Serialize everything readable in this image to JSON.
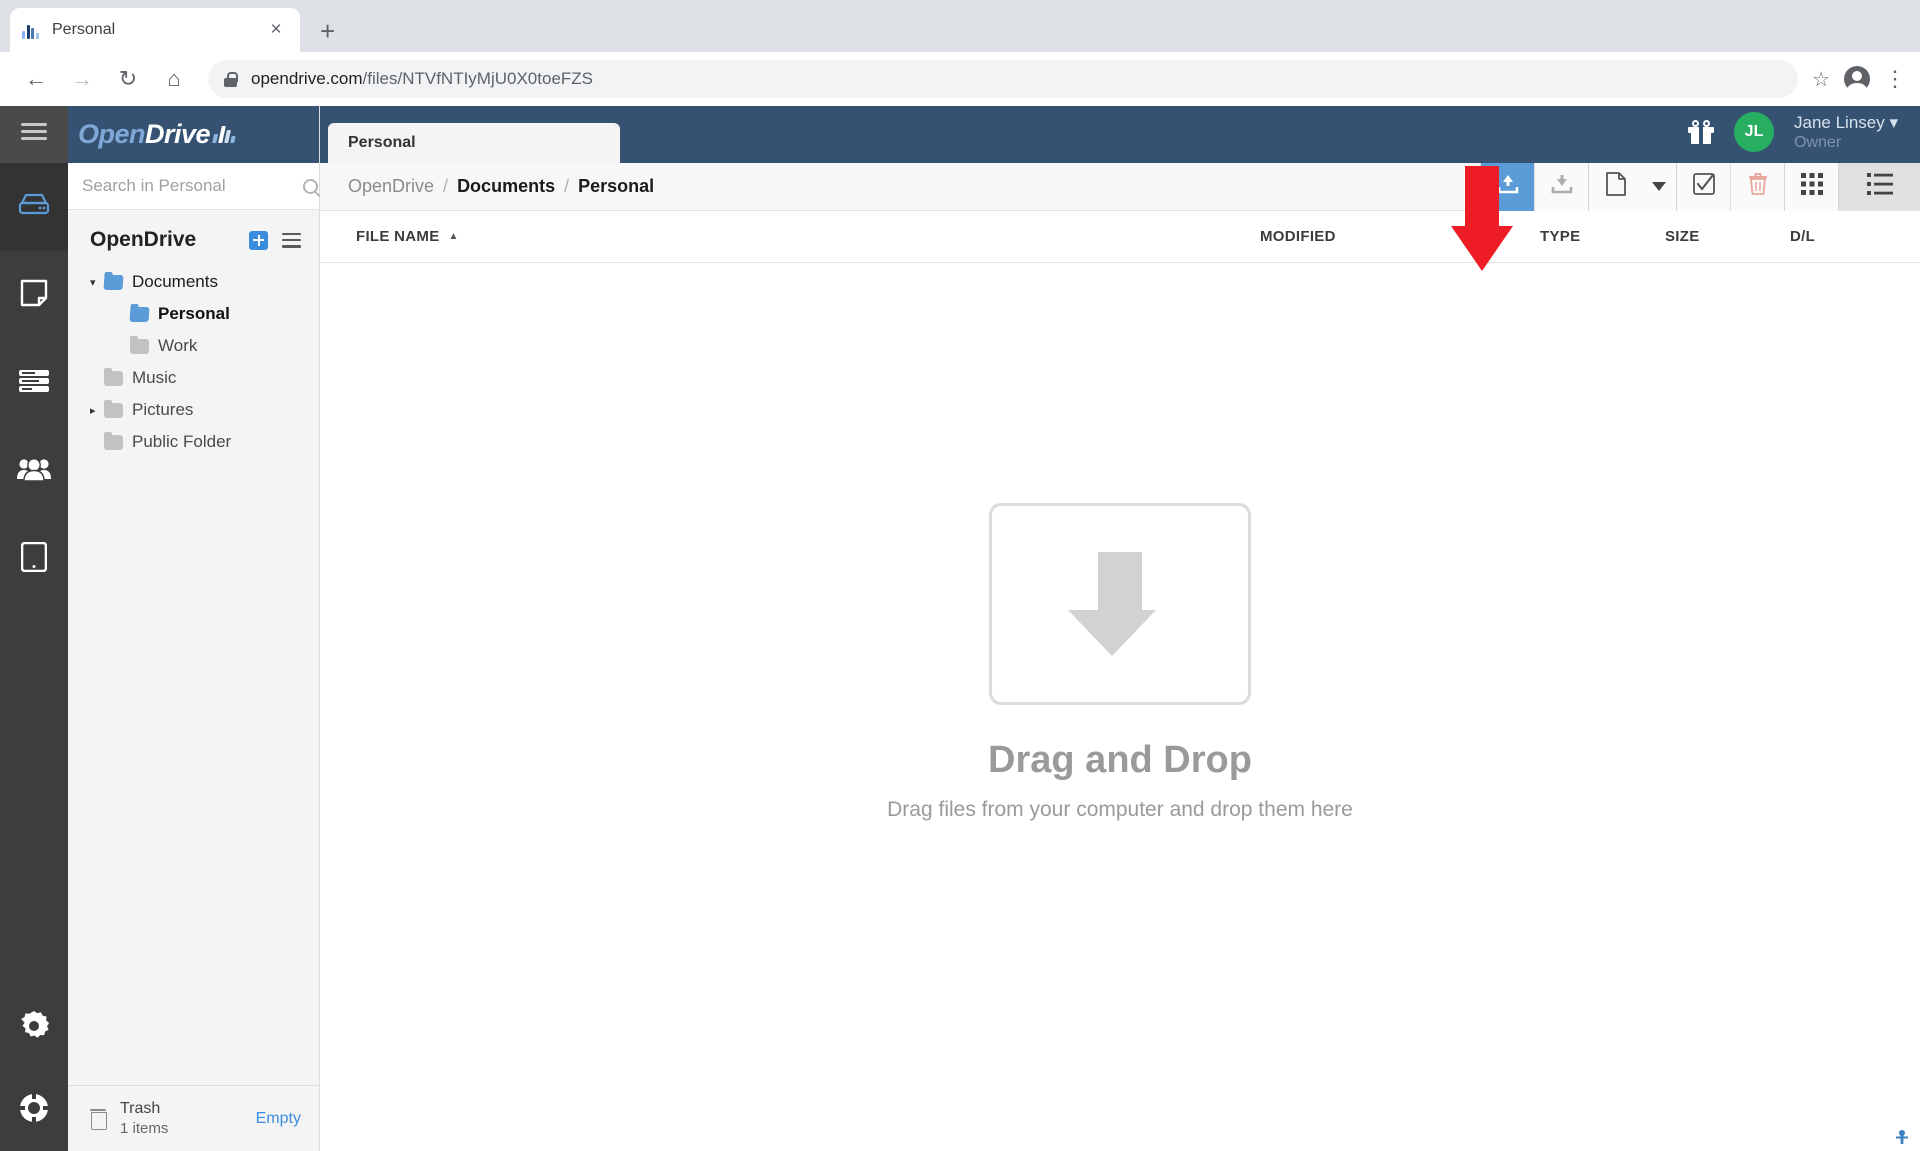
{
  "browser": {
    "tab": {
      "title": "Personal",
      "favicon": "opendrive-favicon",
      "close_label": "×"
    },
    "new_tab_label": "+",
    "nav": {
      "back": "←",
      "forward": "→",
      "reload": "↻",
      "home": "⌂"
    },
    "url": {
      "domain": "opendrive.com",
      "path": "/files/NTVfNTIyMjU0X0toeFZS"
    },
    "star_label": "☆",
    "menu_label": "⋮"
  },
  "rail": {
    "menu_icon": "hamburger-icon",
    "items": [
      {
        "name": "drive",
        "icon": "drive-icon",
        "active": true
      },
      {
        "name": "notes",
        "icon": "note-icon",
        "active": false
      },
      {
        "name": "tasks",
        "icon": "tasks-icon",
        "active": false
      },
      {
        "name": "contacts",
        "icon": "users-icon",
        "active": false
      },
      {
        "name": "devices",
        "icon": "tablet-icon",
        "active": false
      }
    ],
    "bottom": [
      {
        "name": "settings",
        "icon": "gear-icon"
      },
      {
        "name": "support",
        "icon": "lifebuoy-icon"
      }
    ]
  },
  "brand": {
    "open": "Open",
    "drive": "Drive"
  },
  "search": {
    "placeholder": "Search in Personal",
    "value": ""
  },
  "sidebar": {
    "title": "OpenDrive",
    "add_label": "add-folder",
    "menu_label": "sidebar-menu",
    "tree": [
      {
        "label": "Documents",
        "caret": "▾",
        "folder": "blue",
        "indent": false,
        "style": "dark"
      },
      {
        "label": "Personal",
        "caret": "",
        "folder": "blue",
        "indent": true,
        "style": "bold"
      },
      {
        "label": "Work",
        "caret": "",
        "folder": "gray",
        "indent": true,
        "style": "normal"
      },
      {
        "label": "Music",
        "caret": "",
        "folder": "gray",
        "indent": false,
        "style": "normal"
      },
      {
        "label": "Pictures",
        "caret": "▸",
        "folder": "gray",
        "indent": false,
        "style": "normal"
      },
      {
        "label": "Public Folder",
        "caret": "",
        "folder": "gray",
        "indent": false,
        "style": "normal"
      }
    ],
    "trash": {
      "label": "Trash",
      "count": "1 items",
      "empty_label": "Empty"
    }
  },
  "header": {
    "tab_label": "Personal",
    "gift_label": "rewards",
    "user": {
      "initials": "JL",
      "name": "Jane Linsey ▾",
      "role": "Owner"
    }
  },
  "breadcrumb": {
    "items": [
      {
        "label": "OpenDrive",
        "bold": false
      },
      {
        "label": "Documents",
        "bold": true
      },
      {
        "label": "Personal",
        "bold": true
      }
    ],
    "separator": "/"
  },
  "toolbar": {
    "buttons": [
      {
        "name": "upload",
        "icon": "upload-icon",
        "state": "primary"
      },
      {
        "name": "download",
        "icon": "download-icon",
        "state": "disabled"
      },
      {
        "name": "new-file",
        "icon": "new-file-icon",
        "state": "normal"
      },
      {
        "name": "new-file-dropdown",
        "icon": "chevron-down-icon",
        "state": "normal"
      },
      {
        "name": "select-all",
        "icon": "checkbox-icon",
        "state": "normal"
      },
      {
        "name": "delete",
        "icon": "trash-icon",
        "state": "danger"
      },
      {
        "name": "grid-view",
        "icon": "grid-icon",
        "state": "normal"
      },
      {
        "name": "list-view",
        "icon": "list-icon",
        "state": "active"
      }
    ]
  },
  "table": {
    "columns": [
      {
        "key": "name",
        "label": "FILE NAME",
        "sort": "▲"
      },
      {
        "key": "modified",
        "label": "MODIFIED",
        "sort": ""
      },
      {
        "key": "type",
        "label": "TYPE",
        "sort": ""
      },
      {
        "key": "size",
        "label": "SIZE",
        "sort": ""
      },
      {
        "key": "dl",
        "label": "D/L",
        "sort": ""
      }
    ],
    "rows": []
  },
  "dropzone": {
    "title": "Drag and Drop",
    "subtitle": "Drag files from your computer and drop them here",
    "icon": "download-arrow-icon"
  },
  "annotation": {
    "arrow": "red-down-arrow",
    "points_to": "upload-button"
  },
  "colors": {
    "brand_navy": "#355272",
    "accent_blue": "#5b9bd8",
    "avatar_green": "#27ae60",
    "danger_red": "#ee1c25",
    "rail_dark": "#3d3d3d"
  }
}
